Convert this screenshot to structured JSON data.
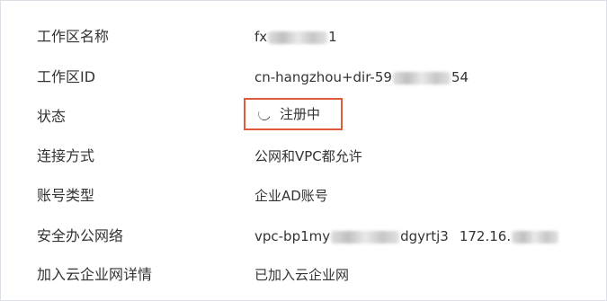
{
  "details": {
    "workspace_name": {
      "label": "工作区名称",
      "value_prefix": "fx",
      "value_suffix": "1"
    },
    "workspace_id": {
      "label": "工作区ID",
      "value_prefix": "cn-hangzhou+dir-59",
      "value_suffix": "54"
    },
    "status": {
      "label": "状态",
      "value": "注册中",
      "icon": "loading-spinner-icon",
      "highlight_color": "#e05a3c"
    },
    "connection": {
      "label": "连接方式",
      "value": "公网和VPC都允许"
    },
    "account_type": {
      "label": "账号类型",
      "value": "企业AD账号"
    },
    "office_network": {
      "label": "安全办公网络",
      "vpc_prefix": "vpc-bp1my",
      "vpc_suffix": "dgyrtj3",
      "cidr_prefix": "172.16."
    },
    "cen": {
      "label": "加入云企业网详情",
      "value": "已加入云企业网"
    }
  }
}
